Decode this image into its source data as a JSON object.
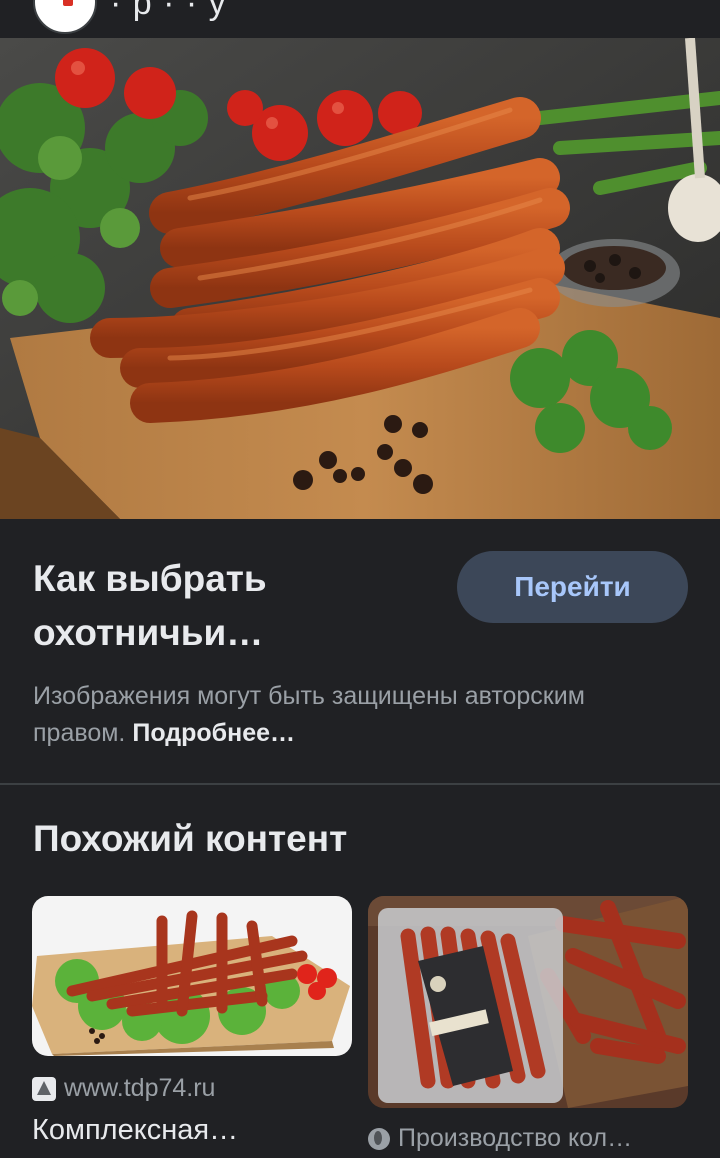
{
  "header": {
    "partial_text": "·  р    ·    ·    у"
  },
  "result": {
    "title": "Как выбрать охотничьи…",
    "go_button": "Перейти",
    "copyright_text": "Изображения могут быть защищены авторским правом.",
    "more_link": "Подробнее…"
  },
  "related": {
    "title": "Похожий контент",
    "cards": [
      {
        "source": "www.tdp74.ru",
        "title": "Комплексная…",
        "icon": "site-logo-icon"
      },
      {
        "source": "Производство кол…",
        "title": "",
        "icon": "globe-icon"
      }
    ]
  },
  "colors": {
    "background": "#202124",
    "button_bg": "#3c4758",
    "button_text": "#a8c7fa",
    "secondary_text": "#9aa0a6"
  }
}
